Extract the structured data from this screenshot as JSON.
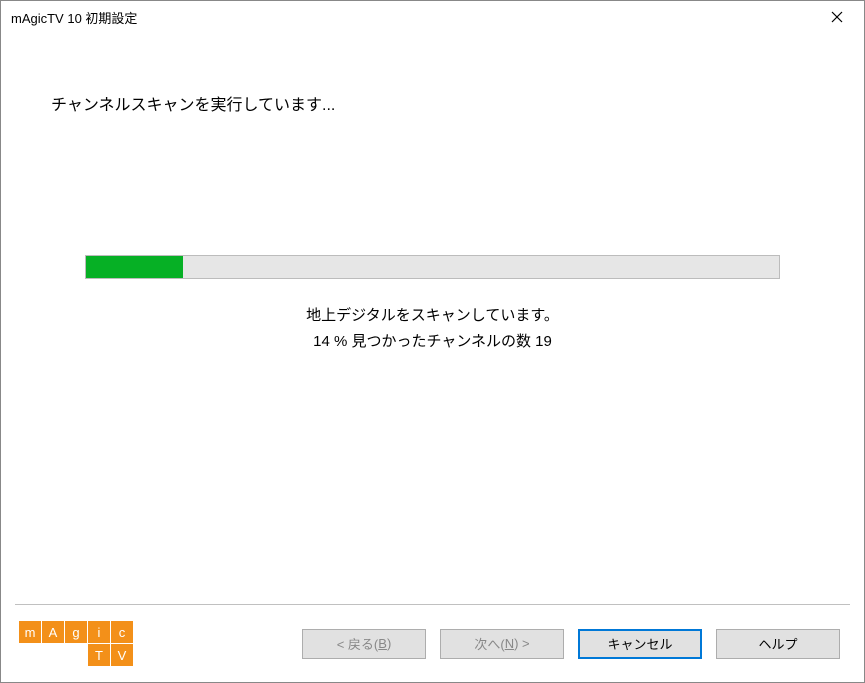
{
  "titlebar": {
    "title": "mAgicTV 10 初期設定"
  },
  "content": {
    "heading": "チャンネルスキャンを実行しています...",
    "progress_percent": 14,
    "status_line1": "地上デジタルをスキャンしています。",
    "status_line2_prefix": "14 % 見つかったチャンネルの数 19"
  },
  "logo": {
    "row1": [
      "m",
      "A",
      "g",
      "i",
      "c"
    ],
    "row2": [
      "T",
      "V"
    ]
  },
  "buttons": {
    "back_prefix": "< 戻る(",
    "back_key": "B",
    "back_suffix": ")",
    "next_prefix": "次へ(",
    "next_key": "N",
    "next_suffix": ") >",
    "cancel": "キャンセル",
    "help": "ヘルプ"
  }
}
